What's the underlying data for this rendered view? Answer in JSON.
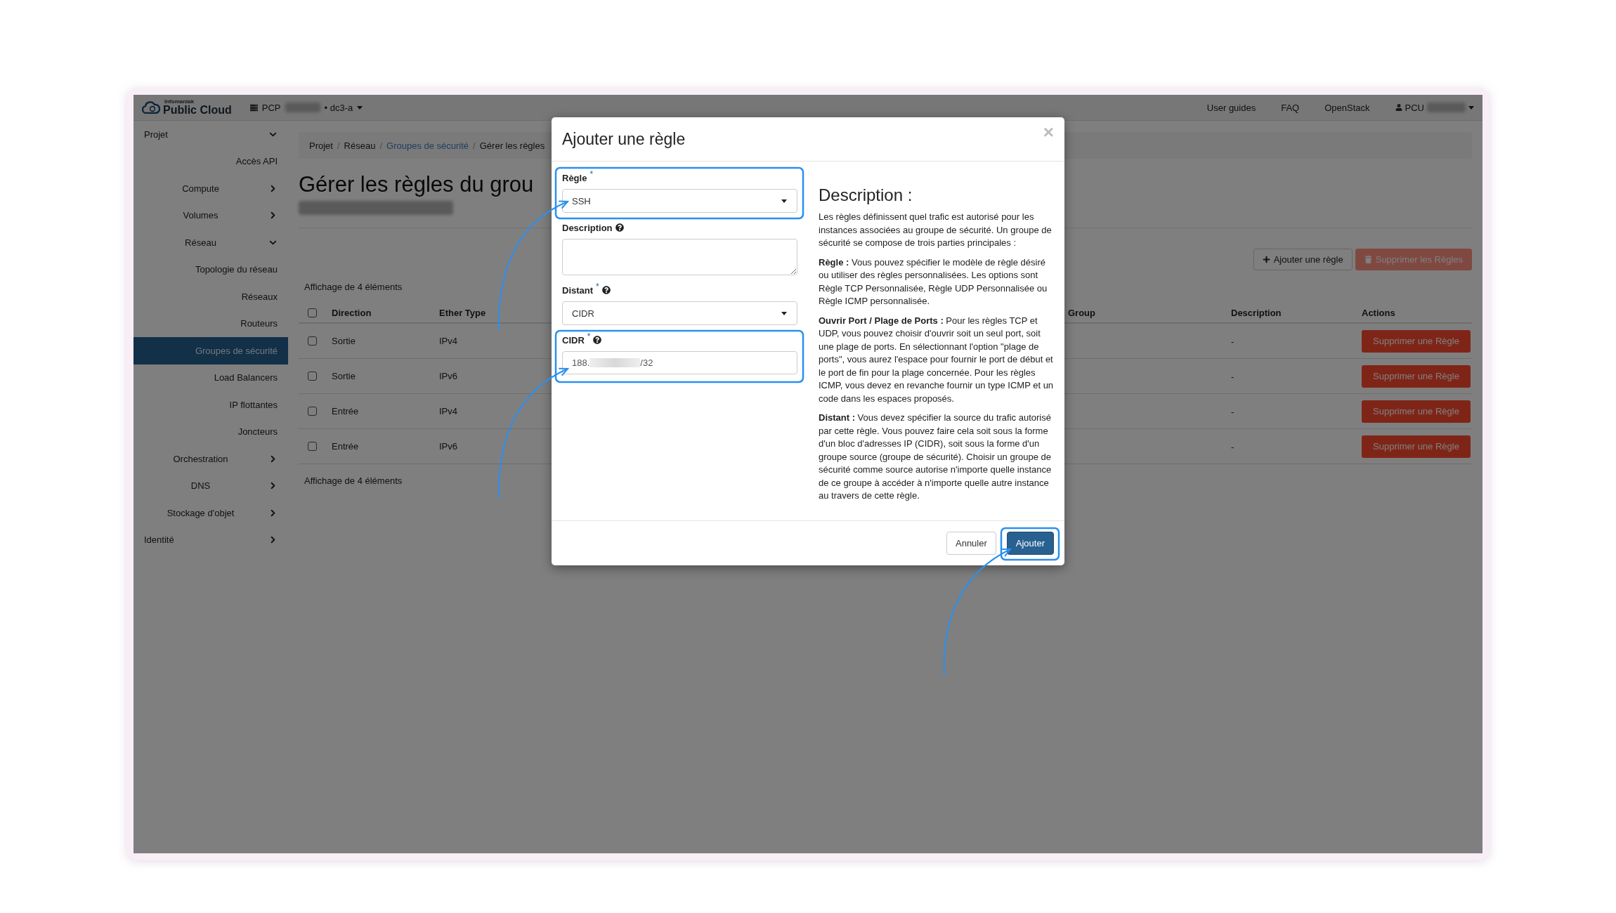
{
  "topbar": {
    "brand_small": "Infomaniak",
    "brand": "Public Cloud",
    "project_label": "PCP",
    "region": "• dc3-a",
    "links": [
      "User guides",
      "FAQ",
      "OpenStack"
    ],
    "user": "PCU"
  },
  "sidebar": {
    "items": [
      {
        "label": "Projet",
        "kind": "group",
        "expanded": true,
        "children": [
          {
            "label": "Accès API",
            "kind": "link",
            "selected": false
          },
          {
            "label": "Compute",
            "kind": "group",
            "expanded": false
          },
          {
            "label": "Volumes",
            "kind": "group",
            "expanded": false
          },
          {
            "label": "Réseau",
            "kind": "group",
            "expanded": true,
            "children": [
              {
                "label": "Topologie du réseau",
                "kind": "link",
                "selected": false
              },
              {
                "label": "Réseaux",
                "kind": "link",
                "selected": false
              },
              {
                "label": "Routeurs",
                "kind": "link",
                "selected": false
              },
              {
                "label": "Groupes de sécurité",
                "kind": "link",
                "selected": true
              },
              {
                "label": "Load Balancers",
                "kind": "link",
                "selected": false
              },
              {
                "label": "IP flottantes",
                "kind": "link",
                "selected": false
              },
              {
                "label": "Joncteurs",
                "kind": "link",
                "selected": false
              }
            ]
          },
          {
            "label": "Orchestration",
            "kind": "group",
            "expanded": false
          },
          {
            "label": "DNS",
            "kind": "group",
            "expanded": false
          },
          {
            "label": "Stockage d'objet",
            "kind": "group",
            "expanded": false
          }
        ]
      },
      {
        "label": "Identité",
        "kind": "group",
        "expanded": false
      }
    ]
  },
  "breadcrumb": {
    "separator": "/",
    "items": [
      {
        "label": "Projet",
        "kind": "text"
      },
      {
        "label": "Réseau",
        "kind": "text"
      },
      {
        "label": "Groupes de sécurité",
        "kind": "link"
      },
      {
        "label": "Gérer les règles",
        "kind": "text"
      }
    ]
  },
  "page": {
    "title": "Gérer les règles du grou"
  },
  "toolbar": {
    "buttons": [
      {
        "label": "Ajouter une règle",
        "kind": "add",
        "disabled": false
      },
      {
        "label": "Supprimer les Règles",
        "kind": "delete",
        "disabled": true
      }
    ]
  },
  "table": {
    "info_top": "Affichage de 4 éléments",
    "select_all_checked": false,
    "columns": [
      "Direction",
      "Ether Type",
      "Group",
      "Description",
      "Actions"
    ],
    "rows": [
      {
        "checked": false,
        "direction": "Sortie",
        "ether_type": "IPv4",
        "description": "-",
        "action": "Supprimer une Règle"
      },
      {
        "checked": false,
        "direction": "Sortie",
        "ether_type": "IPv6",
        "description": "-",
        "action": "Supprimer une Règle"
      },
      {
        "checked": false,
        "direction": "Entrée",
        "ether_type": "IPv4",
        "description": "-",
        "action": "Supprimer une Règle"
      },
      {
        "checked": false,
        "direction": "Entrée",
        "ether_type": "IPv6",
        "description": "-",
        "action": "Supprimer une Règle"
      }
    ],
    "info_bottom": "Affichage de 4 éléments"
  },
  "modal": {
    "title": "Ajouter une règle",
    "close": "×",
    "required_mark": "*",
    "fields": [
      {
        "kind": "select",
        "label": "Règle",
        "required": true,
        "help": false,
        "value": "SSH"
      },
      {
        "kind": "textarea",
        "label": "Description",
        "required": false,
        "help": true
      },
      {
        "kind": "select",
        "label": "Distant",
        "required": true,
        "help": true,
        "value": "CIDR"
      },
      {
        "kind": "text",
        "label": "CIDR",
        "required": true,
        "help": true,
        "value_start": "188.",
        "value_end": "/32"
      }
    ],
    "help_title": "Description :",
    "help_paragraphs": [
      "Les règles définissent quel trafic est autorisé pour les instances associées au groupe de sécurité. Un groupe de sécurité se compose de trois parties principales :",
      "**Règle :** Vous pouvez spécifier le modèle de règle désiré ou utiliser des règles personnalisées. Les options sont Règle TCP Personnalisée, Règle UDP Personnalisée ou Règle ICMP personnalisée.",
      "**Ouvrir Port / Plage de Ports :** Pour les règles TCP et UDP, vous pouvez choisir d'ouvrir soit un seul port, soit une plage de ports. En sélectionnant l'option \"plage de ports\", vous aurez l'espace pour fournir le port de début et le port de fin pour la plage concernée. Pour les règles ICMP, vous devez en revanche fournir un type ICMP et un code dans les espaces proposés.",
      "**Distant :** Vous devez spécifier la source du trafic autorisé par cette règle. Vous pouvez faire cela soit sous la forme d'un bloc d'adresses IP (CIDR), soit sous la forme d'un groupe source (groupe de sécurité). Choisir un groupe de sécurité comme source autorise n'importe quelle instance de ce groupe à accéder à n'importe quelle autre instance au travers de cette règle."
    ],
    "buttons": [
      {
        "label": "Annuler",
        "kind": "default"
      },
      {
        "label": "Ajouter",
        "kind": "primary"
      }
    ]
  }
}
